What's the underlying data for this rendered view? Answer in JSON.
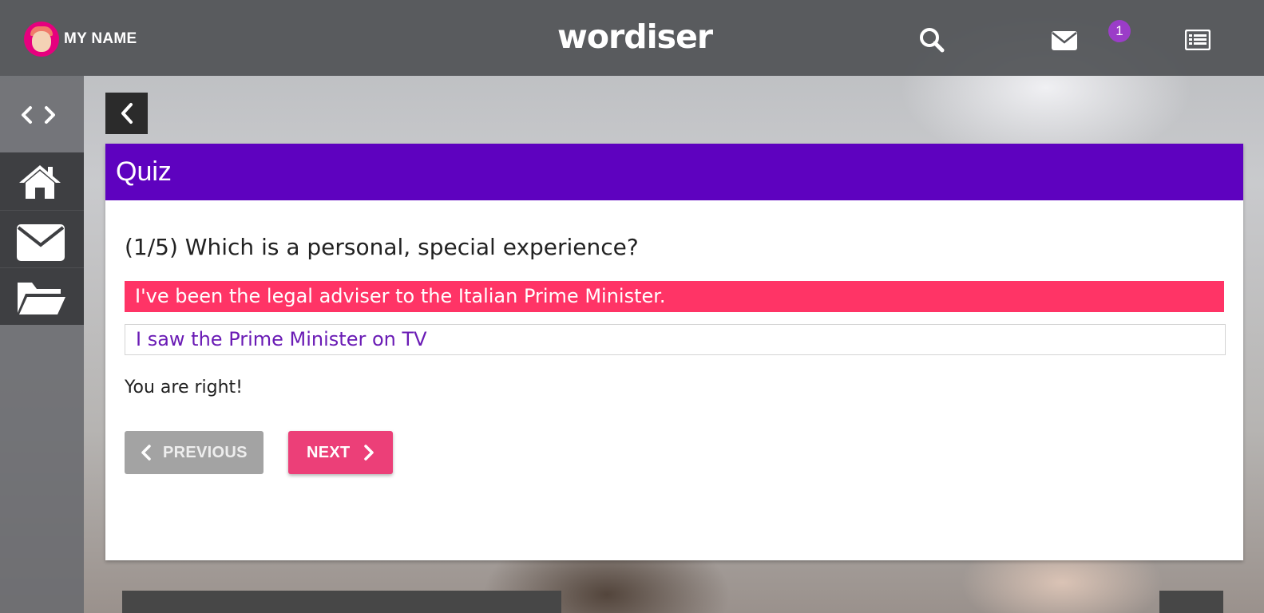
{
  "user": {
    "name": "MY NAME"
  },
  "header": {
    "logo": "wordiser",
    "notification_count": "1"
  },
  "quiz": {
    "title": "Quiz",
    "question": "(1/5) Which is a personal, special experience?",
    "answers": [
      {
        "text": "I've been the legal adviser to the Italian Prime Minister.",
        "selected": true
      },
      {
        "text": "I saw the Prime Minister on TV",
        "selected": false
      }
    ],
    "feedback": "You are right!",
    "previous_label": "PREVIOUS",
    "next_label": "NEXT"
  },
  "colors": {
    "header": "#5e02bf",
    "selected_answer": "#ff3466",
    "next_button": "#ec3f78",
    "badge": "#9b3dc8"
  }
}
